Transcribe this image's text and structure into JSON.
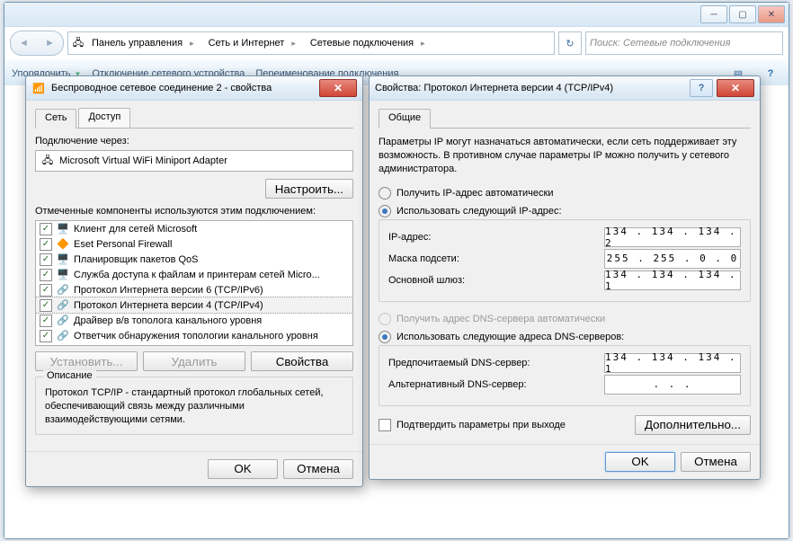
{
  "explorer": {
    "breadcrumbs": [
      "Панель управления",
      "Сеть и Интернет",
      "Сетевые подключения"
    ],
    "search_placeholder": "Поиск: Сетевые подключения",
    "toolbar": {
      "organize": "Упорядочить",
      "disable": "Отключение сетевого устройства",
      "rename": "Переименование подключения"
    }
  },
  "dlg1": {
    "title": "Беспроводное сетевое соединение 2 - свойства",
    "tab_network": "Сеть",
    "tab_access": "Доступ",
    "connect_via": "Подключение через:",
    "adapter": "Microsoft Virtual WiFi Miniport Adapter",
    "configure_btn": "Настроить...",
    "components_used": "Отмеченные компоненты используются этим подключением:",
    "components": [
      "Клиент для сетей Microsoft",
      "Eset Personal Firewall",
      "Планировщик пакетов QoS",
      "Служба доступа к файлам и принтерам сетей Micro...",
      "Протокол Интернета версии 6 (TCP/IPv6)",
      "Протокол Интернета версии 4 (TCP/IPv4)",
      "Драйвер в/в тополога канального уровня",
      "Ответчик обнаружения топологии канального уровня"
    ],
    "install_btn": "Установить...",
    "uninstall_btn": "Удалить",
    "properties_btn": "Свойства",
    "desc_header": "Описание",
    "desc_text": "Протокол TCP/IP - стандартный протокол глобальных сетей, обеспечивающий связь между различными взаимодействующими сетями.",
    "ok": "OK",
    "cancel": "Отмена"
  },
  "dlg2": {
    "title": "Свойства: Протокол Интернета версии 4 (TCP/IPv4)",
    "tab_general": "Общие",
    "note": "Параметры IP могут назначаться автоматически, если сеть поддерживает эту возможность. В противном случае параметры IP можно получить у сетевого администратора.",
    "ip_auto": "Получить IP-адрес автоматически",
    "ip_manual": "Использовать следующий IP-адрес:",
    "ip_label": "IP-адрес:",
    "ip_value": "134 . 134 . 134 .  2",
    "mask_label": "Маска подсети:",
    "mask_value": "255 . 255 .  0  .  0",
    "gw_label": "Основной шлюз:",
    "gw_value": "134 . 134 . 134 .  1",
    "dns_auto": "Получить адрес DNS-сервера автоматически",
    "dns_manual": "Использовать следующие адреса DNS-серверов:",
    "dns1_label": "Предпочитаемый DNS-сервер:",
    "dns1_value": "134 . 134 . 134 .  1",
    "dns2_label": "Альтернативный DNS-сервер:",
    "dns2_value": " .    .    . ",
    "validate": "Подтвердить параметры при выходе",
    "advanced_btn": "Дополнительно...",
    "ok": "OK",
    "cancel": "Отмена"
  }
}
